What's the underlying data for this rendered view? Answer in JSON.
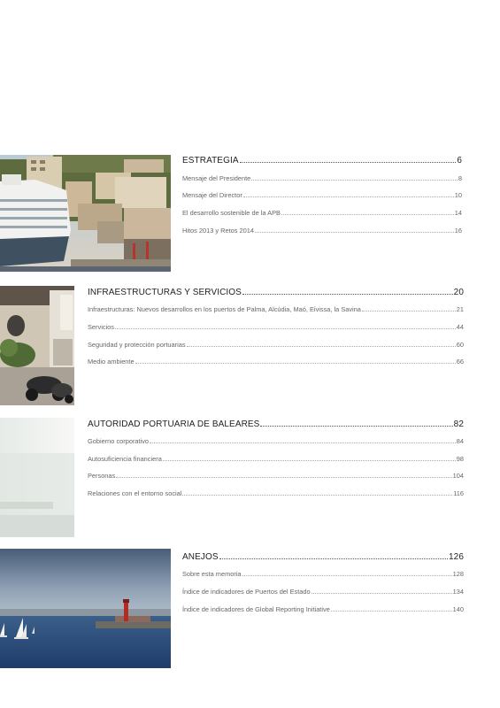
{
  "sections": [
    {
      "title": "ESTRATEGIA",
      "page": "6",
      "items": [
        {
          "label": "Mensaje del Presidente",
          "page": "8"
        },
        {
          "label": "Mensaje del Director",
          "page": "10"
        },
        {
          "label": "El desarrollo sostenible de la APB",
          "page": "14"
        },
        {
          "label": "Hitos 2013 y Retos 2014",
          "page": "16"
        }
      ]
    },
    {
      "title": "INFRAESTRUCTURAS Y SERVICIOS",
      "page": "20",
      "items": [
        {
          "label": "Infraestructuras: Nuevos desarrollos en los puertos de Palma, Alcúdia, Maó, Eivissa, la Savina",
          "page": "21"
        },
        {
          "label": "Servicios",
          "page": "44"
        },
        {
          "label": "Seguridad y protección portuarias",
          "page": "60"
        },
        {
          "label": "Medio ambiente",
          "page": "66"
        }
      ]
    },
    {
      "title": "AUTORIDAD PORTUARIA DE BALEARES",
      "page": "82",
      "items": [
        {
          "label": "Gobierno corporativo",
          "page": "84"
        },
        {
          "label": "Autosuficiencia financiera",
          "page": "98"
        },
        {
          "label": "Personas",
          "page": "104"
        },
        {
          "label": "Relaciones con el entorno social",
          "page": "116"
        }
      ]
    },
    {
      "title": "ANEJOS",
      "page": "126",
      "items": [
        {
          "label": "Sobre esta memoria",
          "page": "128"
        },
        {
          "label": "Índice de indicadores de Puertos del Estado",
          "page": "134"
        },
        {
          "label": "Índice de indicadores de Global Reporting Initiative",
          "page": "140"
        }
      ]
    }
  ]
}
